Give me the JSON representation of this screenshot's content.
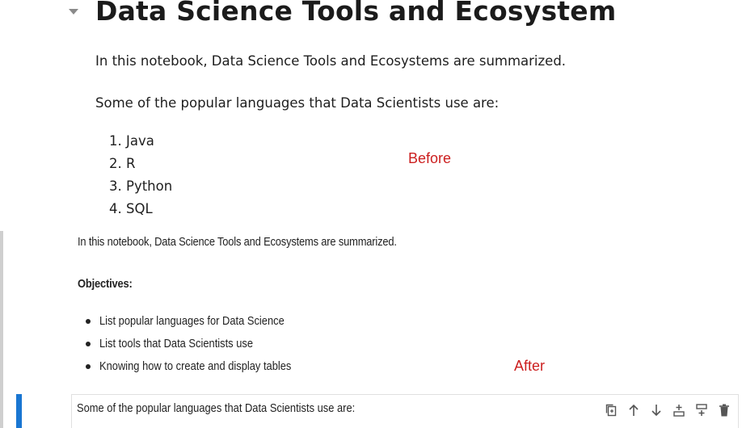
{
  "before": {
    "heading": "Data Science Tools and Ecosystem",
    "intro": "In this notebook, Data Science Tools and Ecosystems are summarized.",
    "languages_intro": "Some of the popular languages that Data Scientists use are:",
    "languages": [
      "1. Java",
      "2. R",
      "3. Python",
      "4. SQL"
    ],
    "marker": "Before"
  },
  "after": {
    "intro": "In this notebook, Data Science Tools and Ecosystems are summarized.",
    "objectives_label": "Objectives:",
    "objectives": [
      "List popular languages for Data Science",
      "List tools that Data Scientists use",
      "Knowing how to create and display tables"
    ],
    "marker": "After"
  },
  "active_cell": {
    "source": "Some of the popular languages that Data Scientists use are:",
    "toolbar": [
      "duplicate-cell-icon",
      "move-up-icon",
      "move-down-icon",
      "insert-above-icon",
      "insert-below-icon",
      "delete-icon"
    ]
  },
  "colors": {
    "marker_red": "#cc1f1f",
    "active_cell_bar": "#1976d2",
    "gutter": "#cfcfcf"
  }
}
